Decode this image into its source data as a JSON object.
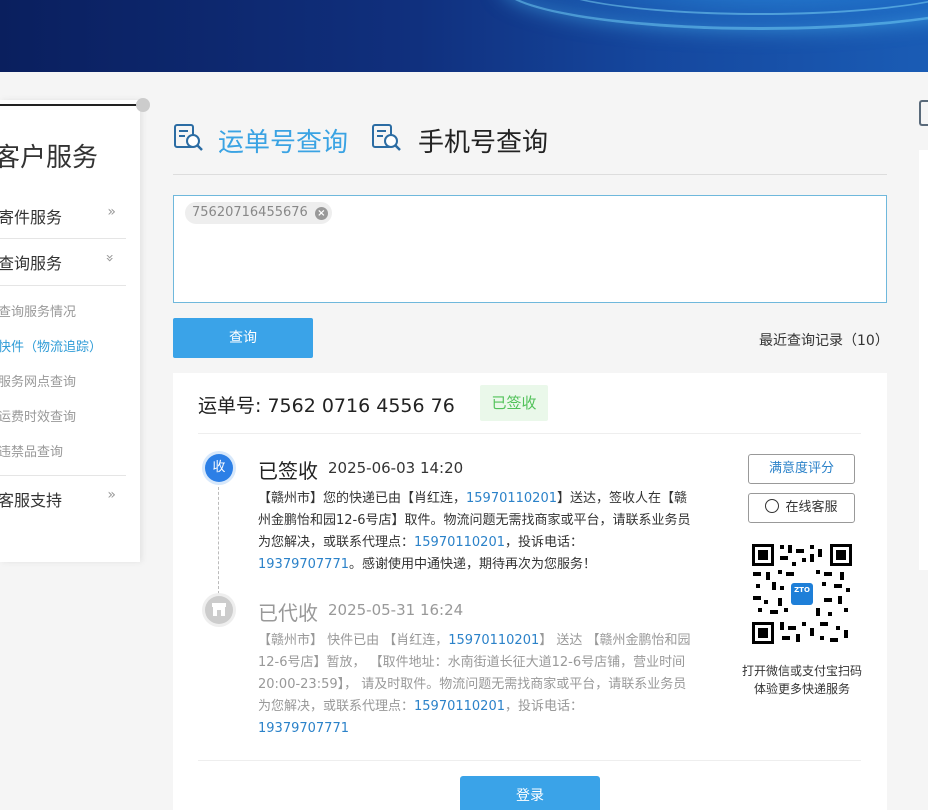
{
  "sidebar": {
    "title": "客户服务",
    "sections": [
      {
        "label": "寄件服务",
        "chevron": "»"
      },
      {
        "label": "查询服务",
        "chevron": "»"
      }
    ],
    "subitems": [
      {
        "label": "查询服务情况",
        "active": false
      },
      {
        "label": "快件（物流追踪）",
        "active": true
      },
      {
        "label": "服务网点查询",
        "active": false
      },
      {
        "label": "运费时效查询",
        "active": false
      },
      {
        "label": "违禁品查询",
        "active": false
      }
    ],
    "support": {
      "label": "客服支持",
      "chevron": "»"
    }
  },
  "tabs": [
    {
      "label": "运单号查询",
      "icon": "search-document-icon",
      "active": true
    },
    {
      "label": "手机号查询",
      "icon": "search-document-icon",
      "active": false
    }
  ],
  "query": {
    "chip_value": "75620716455676",
    "button_label": "查询",
    "recent_label": "最近查询记录（10）"
  },
  "result": {
    "waybill_label": "运单号: 7562 0716 4556 76",
    "status_badge": "已签收",
    "events": [
      {
        "dot_label": "收",
        "status": "已签收",
        "time": "2025-06-03 14:20",
        "body_parts": [
          "【赣州市】您的快递已由【肖红连，",
          "15970110201",
          "】送达，签收人在【赣州金鹏怡和园12-6号店】取件。物流问题无需找商家或平台，请联系业务员为您解决，或联系代理点：",
          "15970110201",
          "，投诉电话：",
          "19379707771",
          "。感谢使用中通快递，期待再次为您服务！"
        ]
      },
      {
        "dot_label": "",
        "dot_icon": "store-icon",
        "status": "已代收",
        "time": "2025-05-31 16:24",
        "body_parts": [
          "【赣州市】 快件已由 【肖红连，",
          "15970110201",
          "】 送达 【赣州金鹏怡和园12-6号店】暂放， 【取件地址：水南街道长征大道12-6号店铺，营业时间20:00-23:59】， 请及时取件。物流问题无需找商家或平台，请联系业务员为您解决，或联系代理点：",
          "15970110201",
          "，投诉电话：",
          "19379707771"
        ]
      }
    ],
    "rate_button": "满意度评分",
    "cs_button": "在线客服",
    "qr_caption_line1": "打开微信或支付宝扫码",
    "qr_caption_line2": "体验更多快递服务",
    "qr_logo_text": "ZTO"
  },
  "login_button": "登录",
  "colors": {
    "accent": "#3aa3e8",
    "link": "#2b82c9",
    "signed_green": "#52c25a",
    "active_tab": "#3aa3e3"
  }
}
